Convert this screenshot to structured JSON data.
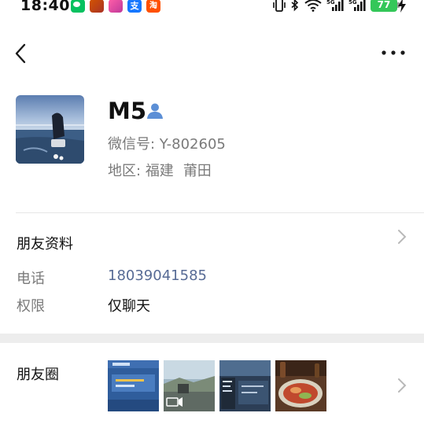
{
  "status_bar": {
    "time": "18:40",
    "app_icons": [
      "wechat-icon",
      "game-icon",
      "vivo-icon",
      "alipay-icon",
      "taobao-icon"
    ],
    "alipay_glyph": "支",
    "taobao_glyph": "淘",
    "network_1": "5G",
    "network_2": "5G",
    "battery_level": "77"
  },
  "profile": {
    "name": "M5",
    "wechat_id": "微信号:  Y-802605",
    "region_label": "地区:",
    "region_province": "福建",
    "region_city": "莆田"
  },
  "friend_info": {
    "title": "朋友资料",
    "phone_label": "电话",
    "phone_value": "18039041585",
    "permission_label": "权限",
    "permission_value": "仅聊天"
  },
  "moments": {
    "title": "朋友圈",
    "thumbnails": [
      "moment-photo-1",
      "moment-photo-2",
      "moment-photo-3",
      "moment-photo-4"
    ]
  },
  "colors": {
    "link": "#576b95",
    "secondary_text": "#7a7a7a",
    "battery": "#34c759",
    "wechat_green": "#07c160"
  }
}
